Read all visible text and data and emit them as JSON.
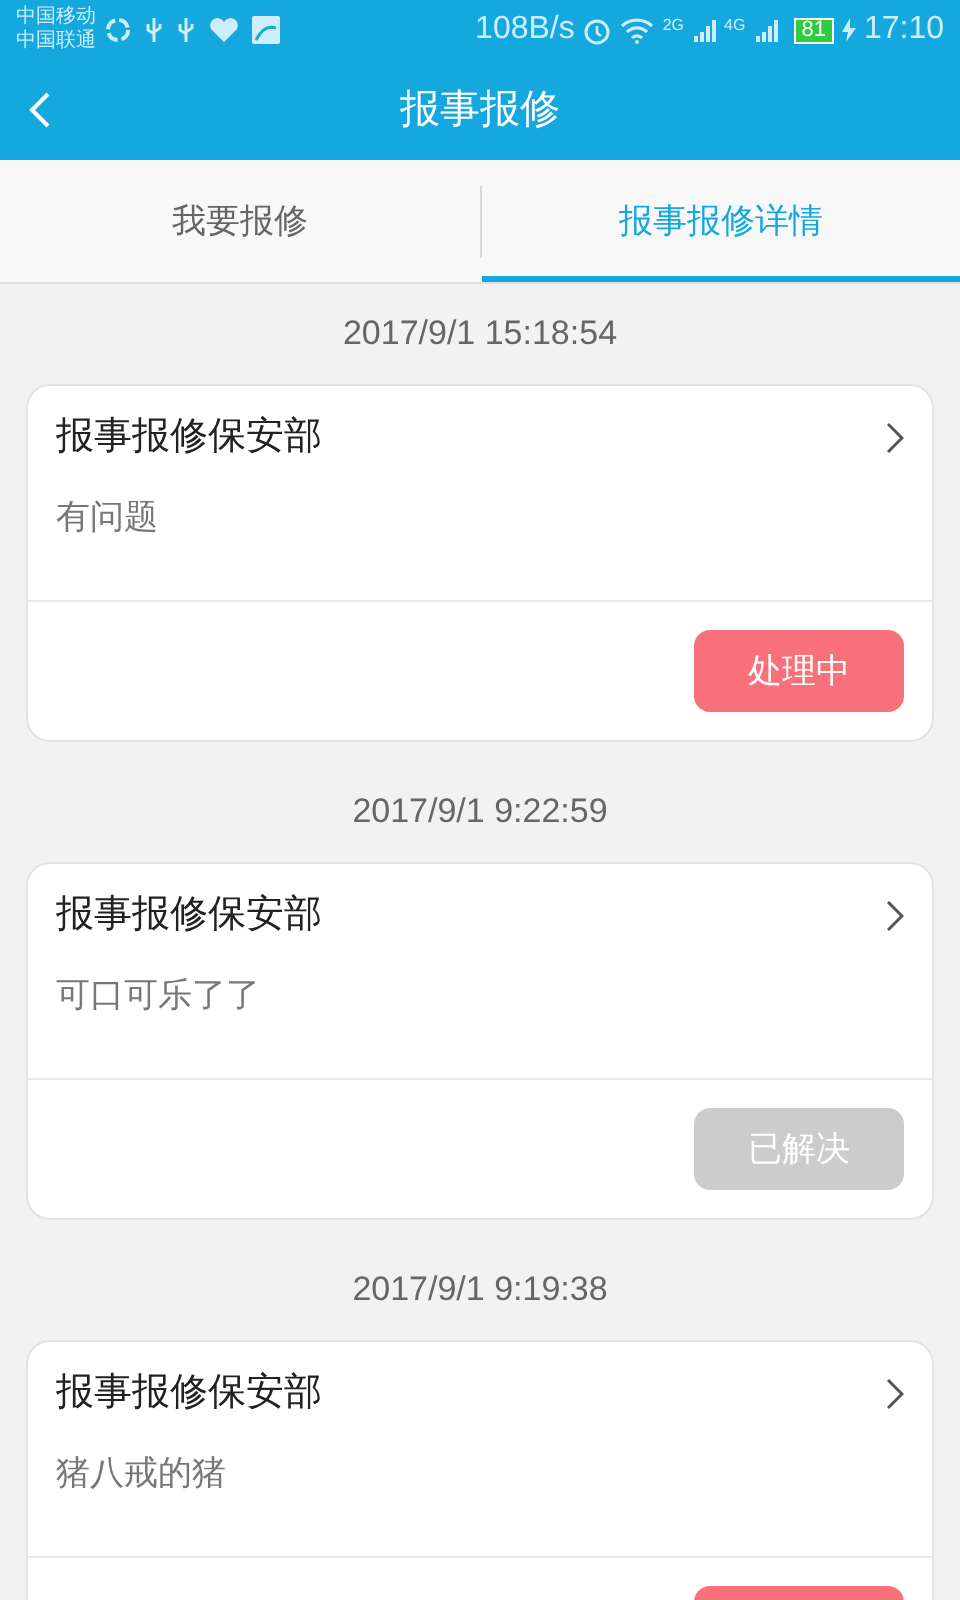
{
  "status_bar": {
    "carriers": [
      "中国移动",
      "中国联通"
    ],
    "net_speed": "108B/s",
    "network_1": "2G",
    "network_2": "4G",
    "battery": "81",
    "time": "17:10"
  },
  "header": {
    "title": "报事报修"
  },
  "tabs": [
    {
      "label": "我要报修",
      "selected": false
    },
    {
      "label": "报事报修详情",
      "selected": true
    }
  ],
  "records": [
    {
      "time": "2017/9/1 15:18:54",
      "title": "报事报修保安部",
      "description": "有问题",
      "status": "处理中",
      "kind": "pending"
    },
    {
      "time": "2017/9/1 9:22:59",
      "title": "报事报修保安部",
      "description": "可口可乐了了",
      "status": "已解决",
      "kind": "resolved"
    },
    {
      "time": "2017/9/1 9:19:38",
      "title": "报事报修保安部",
      "description": "猪八戒的猪",
      "kind": "pending"
    }
  ]
}
